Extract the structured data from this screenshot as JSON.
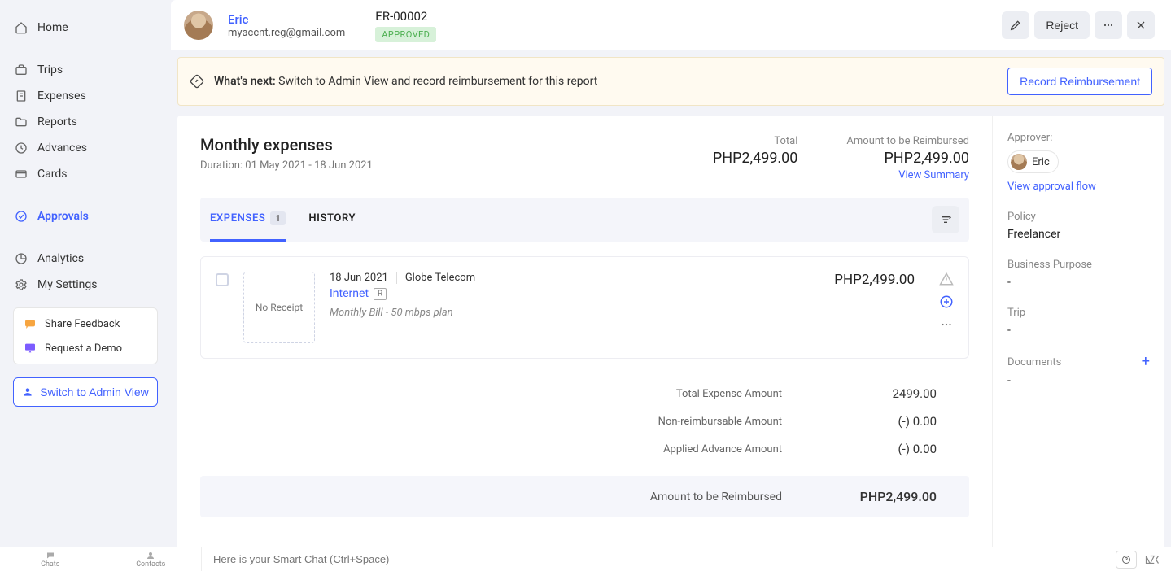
{
  "sidebar": {
    "items": [
      {
        "label": "Home"
      },
      {
        "label": "Trips"
      },
      {
        "label": "Expenses"
      },
      {
        "label": "Reports"
      },
      {
        "label": "Advances"
      },
      {
        "label": "Cards"
      },
      {
        "label": "Approvals"
      },
      {
        "label": "Analytics"
      },
      {
        "label": "My Settings"
      }
    ],
    "feedback": {
      "share": "Share Feedback",
      "demo": "Request a Demo"
    },
    "admin_btn": "Switch to Admin View"
  },
  "header": {
    "user_name": "Eric",
    "user_email": "myaccnt.reg@gmail.com",
    "report_id": "ER-00002",
    "status": "APPROVED",
    "reject_label": "Reject"
  },
  "banner": {
    "title": "What's next:",
    "text": "Switch to Admin View and record reimbursement for this report",
    "button": "Record Reimbursement"
  },
  "report": {
    "title": "Monthly expenses",
    "duration": "Duration: 01 May 2021 - 18 Jun 2021",
    "total_label": "Total",
    "total_value": "PHP2,499.00",
    "reimb_label": "Amount to be Reimbursed",
    "reimb_value": "PHP2,499.00",
    "view_summary": "View Summary"
  },
  "tabs": {
    "expenses": "EXPENSES",
    "expenses_count": "1",
    "history": "HISTORY"
  },
  "expense_item": {
    "no_receipt": "No Receipt",
    "date": "18 Jun 2021",
    "merchant": "Globe Telecom",
    "category": "Internet",
    "cat_badge": "R",
    "description": "Monthly Bill - 50 mbps plan",
    "amount": "PHP2,499.00"
  },
  "totals": {
    "total_expense_label": "Total Expense Amount",
    "total_expense_value": "2499.00",
    "non_reimb_label": "Non-reimbursable Amount",
    "non_reimb_value": "(-) 0.00",
    "applied_adv_label": "Applied Advance Amount",
    "applied_adv_value": "(-) 0.00",
    "reimb_label": "Amount to be Reimbursed",
    "reimb_value": "PHP2,499.00"
  },
  "meta": {
    "approver_label": "Approver:",
    "approver_name": "Eric",
    "view_flow": "View approval flow",
    "policy_label": "Policy",
    "policy_value": "Freelancer",
    "biz_purpose_label": "Business Purpose",
    "biz_purpose_value": "-",
    "trip_label": "Trip",
    "trip_value": "-",
    "documents_label": "Documents",
    "documents_value": "-"
  },
  "footer": {
    "chats": "Chats",
    "contacts": "Contacts",
    "smart_chat_placeholder": "Here is your Smart Chat (Ctrl+Space)"
  }
}
